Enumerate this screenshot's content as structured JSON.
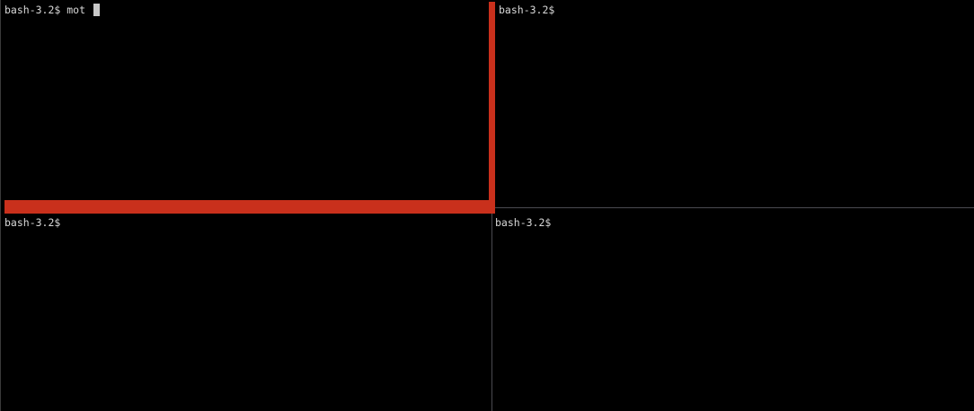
{
  "panes": {
    "top_left": {
      "prompt": "bash-3.2$",
      "input": " mot "
    },
    "top_right": {
      "prompt": "bash-3.2$"
    },
    "bottom_left": {
      "prompt": "bash-3.2$"
    },
    "bottom_right": {
      "prompt": "bash-3.2$"
    }
  },
  "colors": {
    "background": "#000000",
    "text": "#d9d9d9",
    "active_border": "#c9301c",
    "divider": "#4a4a50"
  }
}
